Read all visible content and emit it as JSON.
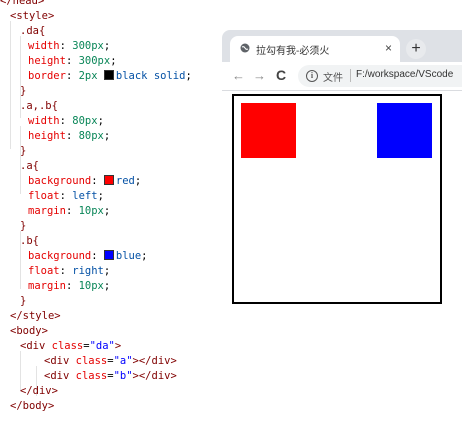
{
  "editor": {
    "lines": [
      {
        "tokens": [
          [
            "punct",
            "</"
          ],
          [
            "tag",
            "head"
          ],
          [
            "punct",
            ">"
          ]
        ]
      },
      {
        "tokens": [
          [
            "punct",
            "<"
          ],
          [
            "tag",
            "style"
          ],
          [
            "punct",
            ">"
          ]
        ]
      },
      {
        "tokens": [
          [
            "sel",
            ".da{"
          ]
        ]
      },
      {
        "tokens": [
          [
            "prop",
            "width"
          ],
          [
            "plain",
            ": "
          ],
          [
            "num",
            "300px"
          ],
          [
            "plain",
            ";"
          ]
        ]
      },
      {
        "tokens": [
          [
            "prop",
            "height"
          ],
          [
            "plain",
            ": "
          ],
          [
            "num",
            "300px"
          ],
          [
            "plain",
            ";"
          ]
        ]
      },
      {
        "tokens": [
          [
            "prop",
            "border"
          ],
          [
            "plain",
            ": "
          ],
          [
            "num",
            "2px "
          ],
          [
            "swatch",
            "#000000"
          ],
          [
            "val",
            "black solid"
          ],
          [
            "plain",
            ";"
          ]
        ]
      },
      {
        "tokens": [
          [
            "sel",
            "}"
          ]
        ]
      },
      {
        "tokens": [
          [
            "sel",
            ".a,.b{"
          ]
        ]
      },
      {
        "tokens": [
          [
            "prop",
            "width"
          ],
          [
            "plain",
            ": "
          ],
          [
            "num",
            "80px"
          ],
          [
            "plain",
            ";"
          ]
        ]
      },
      {
        "tokens": [
          [
            "prop",
            "height"
          ],
          [
            "plain",
            ": "
          ],
          [
            "num",
            "80px"
          ],
          [
            "plain",
            ";"
          ]
        ]
      },
      {
        "tokens": [
          [
            "sel",
            "}"
          ]
        ]
      },
      {
        "tokens": [
          [
            "sel",
            ".a{"
          ]
        ]
      },
      {
        "tokens": [
          [
            "prop",
            "background"
          ],
          [
            "plain",
            ": "
          ],
          [
            "swatch",
            "#ff0000"
          ],
          [
            "val",
            "red"
          ],
          [
            "plain",
            ";"
          ]
        ]
      },
      {
        "tokens": [
          [
            "prop",
            "float"
          ],
          [
            "plain",
            ": "
          ],
          [
            "val",
            "left"
          ],
          [
            "plain",
            ";"
          ]
        ]
      },
      {
        "tokens": [
          [
            "prop",
            "margin"
          ],
          [
            "plain",
            ": "
          ],
          [
            "num",
            "10px"
          ],
          [
            "plain",
            ";"
          ]
        ]
      },
      {
        "tokens": [
          [
            "sel",
            "}"
          ]
        ]
      },
      {
        "tokens": [
          [
            "sel",
            ".b{"
          ]
        ]
      },
      {
        "tokens": [
          [
            "prop",
            "background"
          ],
          [
            "plain",
            ": "
          ],
          [
            "swatch",
            "#0000ff"
          ],
          [
            "val",
            "blue"
          ],
          [
            "plain",
            ";"
          ]
        ]
      },
      {
        "tokens": [
          [
            "prop",
            "float"
          ],
          [
            "plain",
            ": "
          ],
          [
            "val",
            "right"
          ],
          [
            "plain",
            ";"
          ]
        ]
      },
      {
        "tokens": [
          [
            "prop",
            "margin"
          ],
          [
            "plain",
            ": "
          ],
          [
            "num",
            "10px"
          ],
          [
            "plain",
            ";"
          ]
        ]
      },
      {
        "tokens": [
          [
            "sel",
            "}"
          ]
        ]
      },
      {
        "tokens": [
          [
            "punct",
            "</"
          ],
          [
            "tag",
            "style"
          ],
          [
            "punct",
            ">"
          ]
        ]
      },
      {
        "tokens": [
          [
            "punct",
            "<"
          ],
          [
            "tag",
            "body"
          ],
          [
            "punct",
            ">"
          ]
        ]
      },
      {
        "tokens": [
          [
            "punct",
            "<"
          ],
          [
            "tag",
            "div "
          ],
          [
            "attr",
            "class"
          ],
          [
            "plain",
            "="
          ],
          [
            "str",
            "\"da\""
          ],
          [
            "punct",
            ">"
          ]
        ]
      },
      {
        "tokens": [
          [
            "punct",
            "<"
          ],
          [
            "tag",
            "div "
          ],
          [
            "attr",
            "class"
          ],
          [
            "plain",
            "="
          ],
          [
            "str",
            "\"a\""
          ],
          [
            "punct",
            "></"
          ],
          [
            "tag",
            "div"
          ],
          [
            "punct",
            ">"
          ]
        ]
      },
      {
        "tokens": [
          [
            "punct",
            "<"
          ],
          [
            "tag",
            "div "
          ],
          [
            "attr",
            "class"
          ],
          [
            "plain",
            "="
          ],
          [
            "str",
            "\"b\""
          ],
          [
            "punct",
            "></"
          ],
          [
            "tag",
            "div"
          ],
          [
            "punct",
            ">"
          ]
        ]
      },
      {
        "tokens": [
          [
            "punct",
            "</"
          ],
          [
            "tag",
            "div"
          ],
          [
            "punct",
            ">"
          ]
        ]
      },
      {
        "tokens": [
          [
            "punct",
            "</"
          ],
          [
            "tag",
            "body"
          ],
          [
            "punct",
            ">"
          ]
        ]
      }
    ]
  },
  "browser": {
    "tab_title": "拉勾有我-必须火",
    "tab_close": "×",
    "new_tab": "+",
    "back": "←",
    "forward": "→",
    "reload": "C",
    "info": "i",
    "scheme_label": "文件",
    "url": "F:/workspace/VScode"
  },
  "page": {
    "box_a_color": "#ff0000",
    "box_b_color": "#0000ff",
    "container_border": "#000000"
  }
}
